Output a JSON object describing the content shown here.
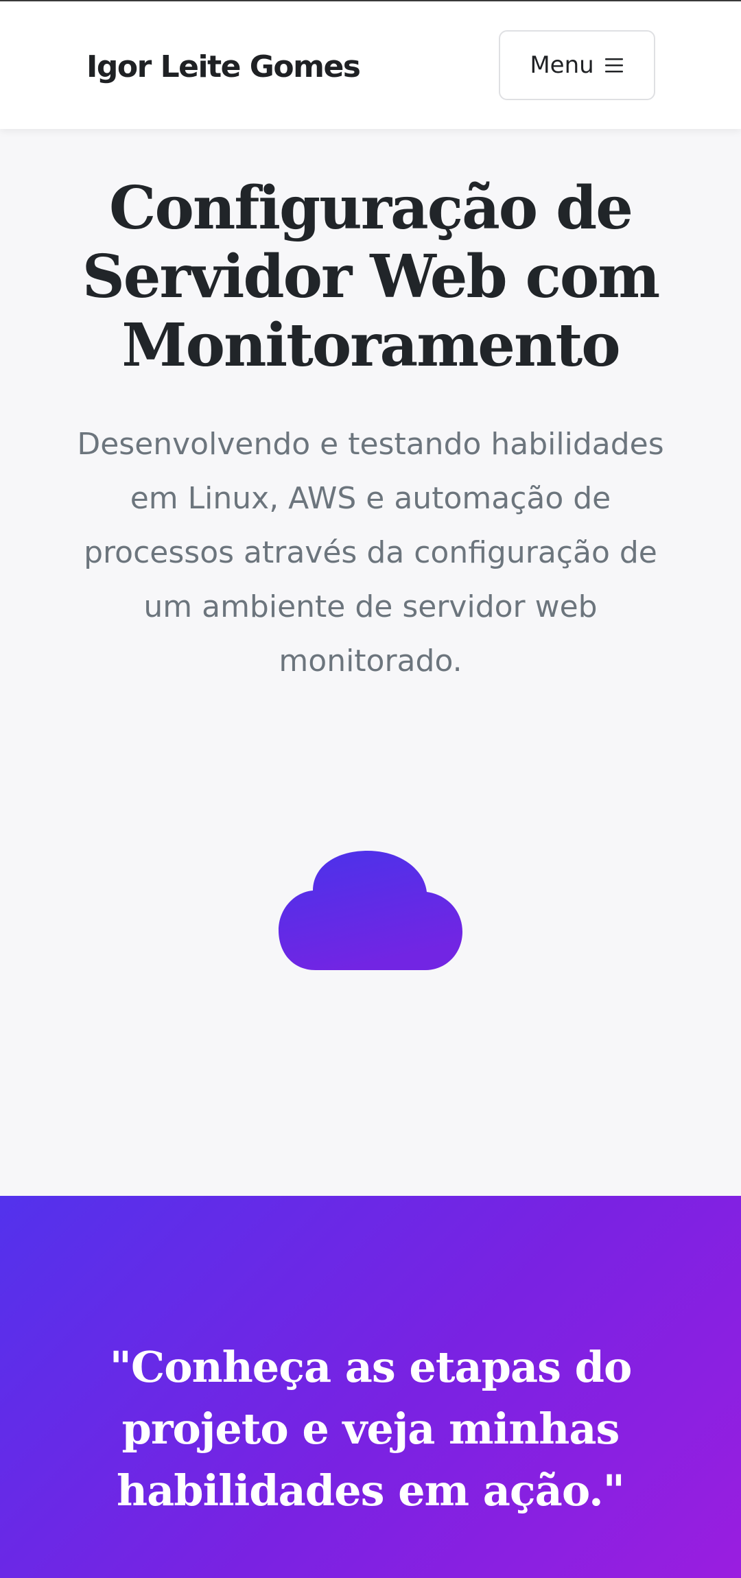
{
  "navbar": {
    "brand": "Igor Leite Gomes",
    "menu_label": "Menu",
    "menu_icon": "hamburger-icon"
  },
  "hero": {
    "title": "Configuração de Servidor Web com Monitoramento",
    "subtitle": "Desenvolvendo e testando habilidades em Linux, AWS e automação de processos através da configuração de um ambiente de servidor web monitorado.",
    "icon": "cloud-icon"
  },
  "quote_section": {
    "quote": "\"Conheça as etapas do projeto e veja minhas habilidades em ação.\""
  },
  "colors": {
    "text_dark": "#212529",
    "text_muted": "#6c757d",
    "gradient_start": "#4a33ea",
    "gradient_end": "#9b1fe0",
    "background": "#f7f7f9"
  }
}
